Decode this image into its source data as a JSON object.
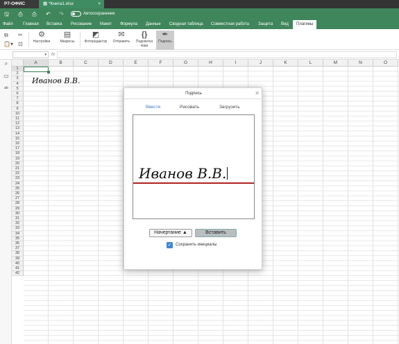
{
  "titlebar": {
    "app_name": "Р7-ОФИС",
    "document_tab": "*Книга1.xlsx",
    "close_glyph": "×"
  },
  "header": {
    "autosave_label": "Автосохранение"
  },
  "menu": [
    "Файл",
    "Главная",
    "Вставка",
    "Рисование",
    "Макет",
    "Формула",
    "Данные",
    "Сводная таблица",
    "Совместная работа",
    "Защита",
    "Вид",
    "Плагины"
  ],
  "active_menu": "Плагины",
  "toolbar": {
    "settings_label": "Настройки",
    "macros_label": "Макросы",
    "photo_editor_label": "Фоторедактор",
    "send_label": "Отправить",
    "code_highlight_label": "Подсветка кода",
    "signature_label": "Подпись"
  },
  "formula_bar": {
    "cell_ref": "",
    "fx_label": "fx",
    "value": ""
  },
  "columns": [
    "A",
    "B",
    "C",
    "D",
    "E",
    "F",
    "G",
    "H",
    "I",
    "J",
    "K",
    "L",
    "M",
    "N",
    "O"
  ],
  "rows": [
    "1",
    "2",
    "3",
    "4",
    "5",
    "6",
    "7",
    "8",
    "9",
    "10",
    "11",
    "12",
    "13",
    "14",
    "15",
    "16",
    "17",
    "18",
    "19",
    "20",
    "21",
    "22",
    "23",
    "24",
    "25",
    "26",
    "27",
    "28",
    "29",
    "30",
    "31",
    "32",
    "33",
    "34",
    "35",
    "36",
    "37",
    "38",
    "39",
    "40",
    "41",
    "42"
  ],
  "selected_cell": {
    "column": "A",
    "row": "1"
  },
  "cell_content": {
    "A3": "Иванов В.В."
  },
  "dialog": {
    "title": "Подпись",
    "tabs": [
      "Ввести",
      "Рисовать",
      "Загрузить"
    ],
    "active_tab": "Ввести",
    "signature_text": "Иванов В.В.",
    "font_button_label": "Начертание ▲",
    "insert_button_label": "Вставить",
    "save_initials_label": "Сохранить инициалы",
    "save_initials_checked": true
  },
  "colors": {
    "brand_green": "#40865c",
    "signature_line": "#b21f1f",
    "active_tab_blue": "#3a7cc0",
    "checkbox_blue": "#3a86d8"
  }
}
